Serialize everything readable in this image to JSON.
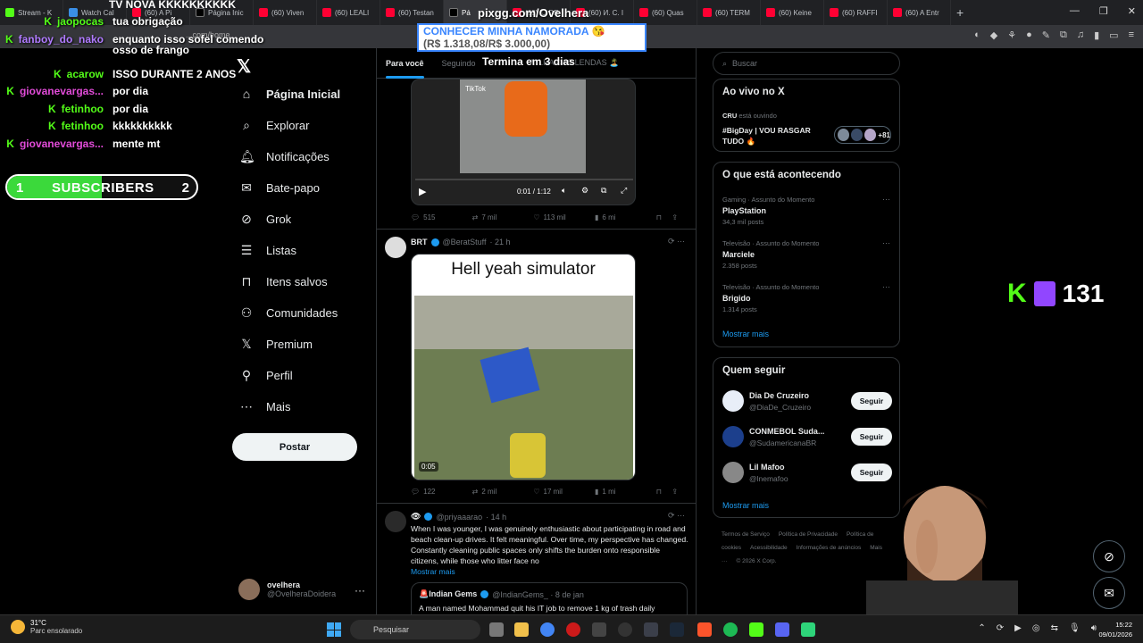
{
  "browser": {
    "tabs": [
      {
        "label": "Stream - K",
        "fav": "kick"
      },
      {
        "label": "Watch Cal",
        "fav": "tv"
      },
      {
        "label": "(60) A Pi",
        "fav": "yt"
      },
      {
        "label": "Página Inic",
        "fav": "x"
      },
      {
        "label": "(60) Viven",
        "fav": "yt"
      },
      {
        "label": "(60) LEALI",
        "fav": "yt"
      },
      {
        "label": "(60) Testan",
        "fav": "yt"
      },
      {
        "label": "Pá",
        "fav": "x",
        "active": true
      },
      {
        "label": "(60) 'O DE",
        "fav": "yt"
      },
      {
        "label": "(60) И. С. I",
        "fav": "yt"
      },
      {
        "label": "(60) Quas",
        "fav": "yt"
      },
      {
        "label": "(60) TERM",
        "fav": "yt"
      },
      {
        "label": "(60) Keine",
        "fav": "yt"
      },
      {
        "label": "(60) RAFFI",
        "fav": "yt"
      },
      {
        "label": "(60) A Entr",
        "fav": "yt"
      }
    ],
    "new_tab": "+",
    "url": "...com/home",
    "window_controls": [
      "—",
      "❐",
      "✕"
    ]
  },
  "overlay": {
    "top_title": "TV NOVA KKKKKKKKKK",
    "pix_url": "pixgg.com/Ovelhera",
    "goal_line1": "CONHECER MINHA NAMORADA 😘",
    "goal_line2": "(R$ 1.318,08/R$ 3.000,00)",
    "goal_ends": "Termina em 3 dias",
    "chat": [
      {
        "user": "jaopocas",
        "msg": "tua obrigação",
        "color": "green",
        "k": true
      },
      {
        "user": "fanboy_do_nako",
        "msg": "enquanto isso sofel comendo",
        "color": "purple",
        "k": true
      },
      {
        "user": "",
        "msg": "osso de frango",
        "color": "green",
        "k": false
      },
      {
        "user": "acarow",
        "msg": "ISSO DURANTE 2 ANOS",
        "color": "green",
        "k": true
      },
      {
        "user": "giovanevargas...",
        "msg": "por dia",
        "color": "pink",
        "k": true
      },
      {
        "user": "fetinhoo",
        "msg": "por dia",
        "color": "green",
        "k": true
      },
      {
        "user": "fetinhoo",
        "msg": "kkkkkkkkkk",
        "color": "green",
        "k": true
      },
      {
        "user": "giovanevargas...",
        "msg": "mente mt",
        "color": "pink",
        "k": true
      }
    ],
    "subs": {
      "start": "1",
      "label": "SUBSCRIBERS",
      "goal": "2",
      "progress": 0.5
    },
    "viewers": {
      "k": "K",
      "count": "131"
    }
  },
  "x": {
    "nav": [
      {
        "icon": "home-icon",
        "glyph": "⌂",
        "label": "Página Inicial",
        "bold": true
      },
      {
        "icon": "search-icon",
        "glyph": "⌕",
        "label": "Explorar"
      },
      {
        "icon": "bell-icon",
        "glyph": "🔔︎",
        "label": "Notificações"
      },
      {
        "icon": "mail-icon",
        "glyph": "✉",
        "label": "Bate-papo"
      },
      {
        "icon": "grok-icon",
        "glyph": "⊘",
        "label": "Grok"
      },
      {
        "icon": "list-icon",
        "glyph": "☰",
        "label": "Listas"
      },
      {
        "icon": "bookmark-icon",
        "glyph": "⊓",
        "label": "Itens salvos"
      },
      {
        "icon": "people-icon",
        "glyph": "⚇",
        "label": "Comunidades"
      },
      {
        "icon": "x-icon",
        "glyph": "𝕏",
        "label": "Premium"
      },
      {
        "icon": "person-icon",
        "glyph": "⚲",
        "label": "Perfil"
      },
      {
        "icon": "more-circle-icon",
        "glyph": "⋯",
        "label": "Mais"
      }
    ],
    "post_label": "Postar",
    "profile": {
      "name": "ovelhera",
      "handle": "@OvelheraDoidera",
      "more": "···"
    },
    "feed_tabs": [
      "Para você",
      "Seguindo",
      "",
      "",
      "A ILHA DAS LENDAS 🏝️"
    ],
    "tweet1": {
      "tiktok": "TikTok",
      "time": "0:01 / 1:12",
      "replies": "515",
      "reposts": "7 mil",
      "likes": "113 mil",
      "views": "6 mi"
    },
    "tweet2": {
      "name": "BRT",
      "handle": "@BeratStuff",
      "time": "· 21 h",
      "caption": "Hell yeah simulator",
      "duration": "0:05",
      "replies": "122",
      "reposts": "2 mil",
      "likes": "17 mil",
      "views": "1 mi"
    },
    "tweet3": {
      "handle": "@priyaaarao",
      "time": "· 14 h",
      "text": "When I was younger, I was genuinely enthusiastic about participating in road and beach clean-up drives. It felt meaningful. Over time, my perspective has changed. Constantly cleaning public spaces only shifts the burden onto responsible citizens, while those who litter face no",
      "show_more": "Mostrar mais",
      "quote_name": "🚨Indian Gems",
      "quote_handle": "@IndianGems_ · 8 de jan",
      "quote_text": "A man named Mohammad quit his IT job to remove 1 kg of trash daily"
    },
    "search_placeholder": "Buscar",
    "live": {
      "title": "Ao vivo no X",
      "host": "CRU",
      "listening": "está ouvindo",
      "space": "#BigDay | VOU RASGAR TUDO 🔥",
      "count": "+81"
    },
    "trends": {
      "title": "O que está acontecendo",
      "items": [
        {
          "cat": "Gaming · Assunto do Momento",
          "name": "PlayStation",
          "count": "34,3 mil posts"
        },
        {
          "cat": "Televisão · Assunto do Momento",
          "name": "Marciele",
          "count": "2.358 posts"
        },
        {
          "cat": "Televisão · Assunto do Momento",
          "name": "Brigido",
          "count": "1.314 posts"
        }
      ],
      "more": "Mostrar mais"
    },
    "who_to_follow": {
      "title": "Quem seguir",
      "items": [
        {
          "name": "Dia De Cruzeiro",
          "handle": "@DiaDe_Cruzeiro",
          "btn": "Seguir",
          "color": "#e8eef8"
        },
        {
          "name": "CONMEBOL Suda...",
          "handle": "@SudamericanaBR",
          "btn": "Seguir",
          "color": "#1c3f8c"
        },
        {
          "name": "Lil Mafoo",
          "handle": "@lnemafoo",
          "btn": "Seguir",
          "color": "#888888"
        }
      ],
      "more": "Mostrar mais"
    },
    "footer": [
      "Termos de Serviço",
      "Política de Privacidade",
      "Política de cookies",
      "Acessibilidade",
      "Informações de anúncios",
      "Mais ···",
      "© 2026 X Corp."
    ]
  },
  "taskbar": {
    "temp": "31°C",
    "weather": "Parc ensolarado",
    "search": "Pesquisar",
    "time": "15:22",
    "date": "09/01/2026"
  },
  "colors": {
    "kick": "#53fc18",
    "x_blue": "#1d9bf0",
    "twitch": "#9146ff"
  }
}
